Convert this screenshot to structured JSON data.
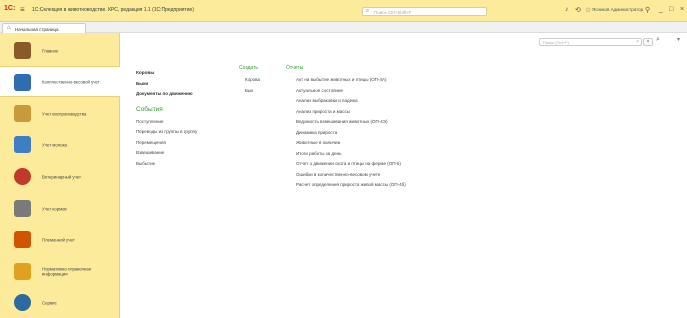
{
  "app": {
    "logo": "1С:",
    "title": "1С:Селекция в животноводстве. КРС, редакция 1.1  (1С:Предприятие)",
    "search_placeholder": "Поиск Ctrl+Shift+F",
    "user": "Ясников Администратор"
  },
  "tabs": {
    "home": "Начальная страница"
  },
  "sidebar": {
    "items": [
      {
        "label": "Главное",
        "color": "#8a5a2b"
      },
      {
        "label": "Количественно-весовой учет",
        "color": "#2f6db3"
      },
      {
        "label": "Учет воспроизводства",
        "color": "#c79a3a"
      },
      {
        "label": "Учет молока",
        "color": "#3e7fc4"
      },
      {
        "label": "Ветеринарный учет",
        "color": "#c0392b"
      },
      {
        "label": "Учет кормов",
        "color": "#7a7a7a"
      },
      {
        "label": "Племенной учет",
        "color": "#d35400"
      },
      {
        "label": "Нормативно-справочная информация",
        "color": "#e0a020"
      },
      {
        "label": "Сервис",
        "color": "#2c6aa0"
      }
    ]
  },
  "main": {
    "search_placeholder": "Поиск (Ctrl+F)",
    "col1": {
      "links": [
        "Коровы",
        "Быки",
        "Документы по движению"
      ],
      "events_title": "События",
      "events": [
        "Поступление",
        "Переводы из группы в группу",
        "Перемещения",
        "Взвешивание",
        "Выбытие"
      ]
    },
    "col2": {
      "head": "Создать",
      "links": [
        "Корова",
        "Бык"
      ]
    },
    "col3": {
      "head": "Отчеты",
      "links": [
        "Акт на выбытие животных и птицы (ОП-4А)",
        "Актуальное состояние",
        "Анализ выбраковки и падежа",
        "Анализ прироста и массы",
        "Ведомость взвешивания животных (ОП-4Э)",
        "Динамика прироста",
        "Животные в наличии",
        "Итоги работы за день",
        "Отчет о движении скота и птицы на ферме (ОП-5)",
        "Ошибки в количественно-весовом учете",
        "Расчет определения прироста живой массы (ОП-4б)"
      ]
    }
  }
}
